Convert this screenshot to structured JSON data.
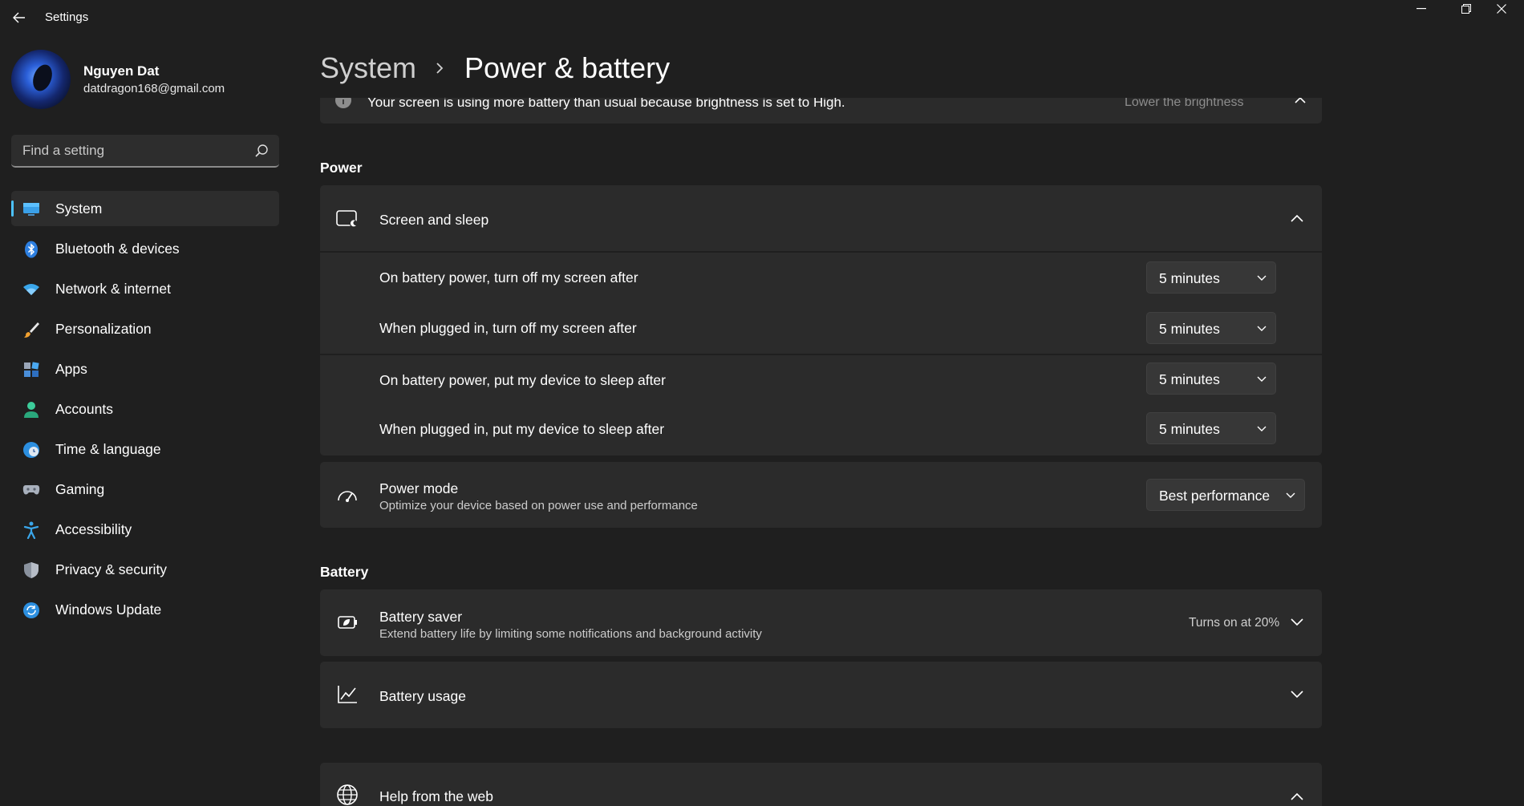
{
  "window": {
    "title": "Settings",
    "back_icon": "back-arrow-icon",
    "controls": [
      "minimize-icon",
      "maximize-icon",
      "close-icon"
    ]
  },
  "profile": {
    "name": "Nguyen Dat",
    "email": "datdragon168@gmail.com"
  },
  "search": {
    "placeholder": "Find a setting",
    "value": ""
  },
  "sidebar": {
    "items": [
      {
        "label": "System",
        "icon": "system-display-icon",
        "active": true
      },
      {
        "label": "Bluetooth & devices",
        "icon": "bluetooth-icon"
      },
      {
        "label": "Network & internet",
        "icon": "wifi-icon"
      },
      {
        "label": "Personalization",
        "icon": "brush-icon"
      },
      {
        "label": "Apps",
        "icon": "apps-icon"
      },
      {
        "label": "Accounts",
        "icon": "person-icon"
      },
      {
        "label": "Time & language",
        "icon": "globe-clock-icon"
      },
      {
        "label": "Gaming",
        "icon": "gamepad-icon"
      },
      {
        "label": "Accessibility",
        "icon": "accessibility-icon"
      },
      {
        "label": "Privacy & security",
        "icon": "shield-icon"
      },
      {
        "label": "Windows Update",
        "icon": "update-icon"
      }
    ]
  },
  "breadcrumb": {
    "parent": "System",
    "current": "Power & battery"
  },
  "banner": {
    "text": "Your screen is using more battery than usual because brightness is set to High.",
    "action": "Lower the brightness"
  },
  "power": {
    "section_title": "Power",
    "screen_sleep": {
      "title": "Screen and sleep",
      "rows": [
        {
          "label": "On battery power, turn off my screen after",
          "value": "5 minutes"
        },
        {
          "label": "When plugged in, turn off my screen after",
          "value": "5 minutes"
        },
        {
          "label": "On battery power, put my device to sleep after",
          "value": "5 minutes"
        },
        {
          "label": "When plugged in, put my device to sleep after",
          "value": "5 minutes"
        }
      ]
    },
    "power_mode": {
      "title": "Power mode",
      "description": "Optimize your device based on power use and performance",
      "value": "Best performance"
    }
  },
  "battery": {
    "section_title": "Battery",
    "saver": {
      "title": "Battery saver",
      "description": "Extend battery life by limiting some notifications and background activity",
      "status": "Turns on at 20%"
    },
    "usage": {
      "title": "Battery usage"
    }
  },
  "help": {
    "title": "Help from the web"
  },
  "colors": {
    "background": "#1f1f1f",
    "card": "#2b2b2b",
    "accent": "#4cc2ff"
  }
}
